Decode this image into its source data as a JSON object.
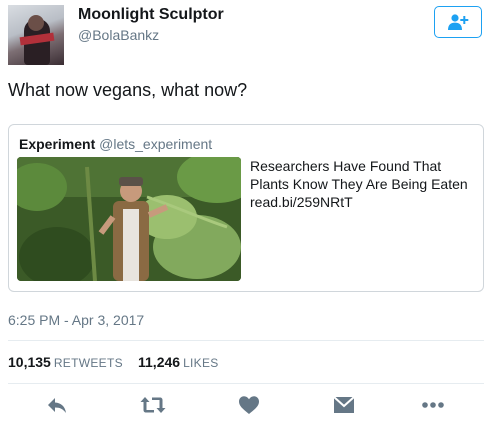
{
  "user": {
    "display_name": "Moonlight Sculptor",
    "handle": "@BolaBankz"
  },
  "follow_button": {
    "icon": "follow-user-icon",
    "color": "#1da1f2"
  },
  "tweet": {
    "text": "What now vegans, what now?"
  },
  "quoted": {
    "author_name": "Experiment",
    "author_handle": "@lets_experiment",
    "headline": "Researchers Have Found That Plants Know They Are Being Eaten",
    "link": "read.bi/259NRtT"
  },
  "meta": {
    "timestamp": "6:25 PM - Apr 3, 2017"
  },
  "stats": {
    "retweets_count": "10,135",
    "retweets_label": "RETWEETS",
    "likes_count": "11,246",
    "likes_label": "LIKES"
  },
  "actions": [
    "reply-icon",
    "retweet-icon",
    "like-icon",
    "direct-message-icon",
    "more-icon"
  ],
  "colors": {
    "icon_gray": "#657786",
    "text": "#14171a",
    "secondary": "#657786",
    "border": "#e6ecf0"
  }
}
